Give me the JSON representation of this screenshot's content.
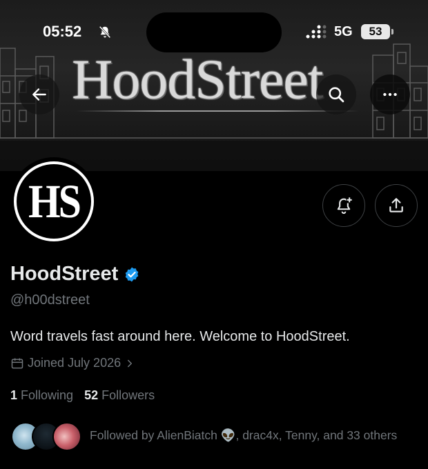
{
  "status_bar": {
    "time": "05:52",
    "bell_icon": "bell-slash-icon",
    "signal_icon": "signal-dots-icon",
    "network": "5G",
    "battery": "53"
  },
  "banner": {
    "title": "HoodStreet"
  },
  "header": {
    "back_icon": "arrow-left-icon",
    "search_icon": "search-icon",
    "more_icon": "more-horizontal-icon"
  },
  "avatar": {
    "text": "HS"
  },
  "actions": {
    "notify_icon": "bell-plus-icon",
    "share_icon": "share-icon"
  },
  "profile": {
    "display_name": "HoodStreet",
    "handle": "@h00dstreet",
    "bio": "Word travels fast around here. Welcome to HoodStreet.",
    "joined": "Joined July 2026",
    "following_count": "1",
    "following_label": "Following",
    "followers_count": "52",
    "followers_label": "Followers",
    "followed_by": "Followed by AlienBiatch 👽, drac4x, Tenny, and 33 others"
  },
  "colors": {
    "background": "#000000",
    "text_primary": "#e7e9ea",
    "text_secondary": "#71767b",
    "verified_blue": "#1d9bf0",
    "border": "#3e4144"
  }
}
